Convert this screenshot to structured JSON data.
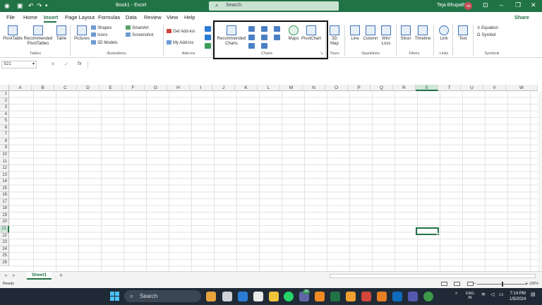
{
  "titlebar": {
    "doc_title": "Book1  -  Excel",
    "search_placeholder": "Search",
    "user_name": "Teja Bhupathi",
    "user_initials": "TB"
  },
  "menu": {
    "tabs": [
      "File",
      "Home",
      "Insert",
      "Page Layout",
      "Formulas",
      "Data",
      "Review",
      "View",
      "Help"
    ],
    "active_tab": "Insert",
    "share_label": "Share"
  },
  "ribbon": {
    "tables": {
      "pivottable": "PivotTable",
      "recommended": "Recommended",
      "pivottables": "PivotTables",
      "table": "Table",
      "label": "Tables"
    },
    "illustrations": {
      "pictures": "Pictures",
      "shapes": "Shapes",
      "icons": "Icons",
      "models": "3D Models",
      "smartart": "SmartArt",
      "screenshot": "Screenshot",
      "label": "Illustrations"
    },
    "addins": {
      "get": "Get Add-ins",
      "my": "My Add-ins",
      "label": "Add-ins"
    },
    "charts": {
      "recommended1": "Recommended",
      "recommended2": "Charts",
      "maps": "Maps",
      "pivotchart": "PivotChart",
      "label": "Charts"
    },
    "tours": {
      "map1": "3D",
      "map2": "Map",
      "label": "Tours"
    },
    "sparklines": {
      "line": "Line",
      "column": "Column",
      "winloss1": "Win/",
      "winloss2": "Loss",
      "label": "Sparklines"
    },
    "filters": {
      "slicer": "Slicer",
      "timeline": "Timeline",
      "label": "Filters"
    },
    "links": {
      "link": "Link",
      "label": "Links"
    },
    "text": {
      "text": "Text"
    },
    "symbols": {
      "equation": "Equation",
      "symbol": "Symbol",
      "label": "Symbols"
    }
  },
  "formula_bar": {
    "name_box": "S21",
    "fx": "fx",
    "value": ""
  },
  "grid": {
    "columns": [
      "A",
      "B",
      "C",
      "D",
      "E",
      "F",
      "G",
      "H",
      "I",
      "J",
      "K",
      "L",
      "M",
      "N",
      "O",
      "P",
      "Q",
      "R",
      "S",
      "T",
      "U",
      "V",
      "W"
    ],
    "rows": [
      "1",
      "2",
      "3",
      "4",
      "5",
      "6",
      "7",
      "8",
      "9",
      "10",
      "11",
      "12",
      "13",
      "14",
      "15",
      "16",
      "17",
      "18",
      "19",
      "20",
      "21",
      "22",
      "23",
      "24",
      "25",
      "26"
    ],
    "selected_column": "S",
    "selected_row": "21"
  },
  "sheets": {
    "tabs": [
      "Sheet1"
    ],
    "add": "+"
  },
  "status": {
    "ready": "Ready",
    "zoom": "100%"
  },
  "taskbar": {
    "search_label": "Search",
    "badge_count": "28",
    "lang1": "ENG",
    "lang2": "IN",
    "time": "7:14 PM",
    "date": "1/5/2024"
  },
  "colors": {
    "excel_green": "#217346",
    "taskbar": "#1f2a36",
    "highlight_border": "#111111"
  }
}
